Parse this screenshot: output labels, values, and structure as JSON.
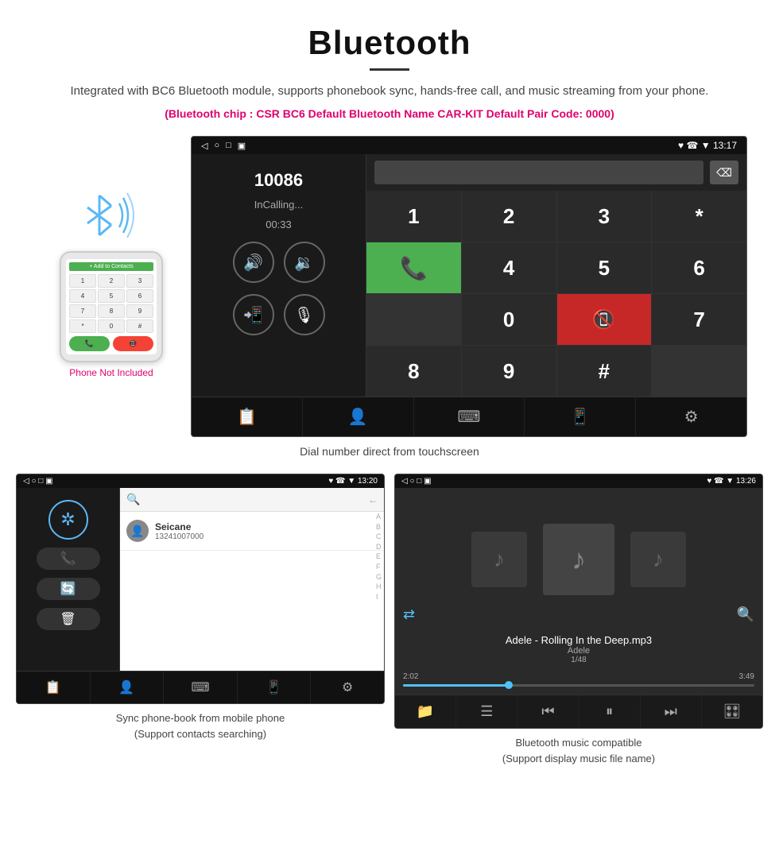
{
  "page": {
    "title": "Bluetooth",
    "divider": true,
    "description": "Integrated with BC6 Bluetooth module, supports phonebook sync, hands-free call, and music streaming from your phone.",
    "specs": "(Bluetooth chip : CSR BC6    Default Bluetooth Name CAR-KIT    Default Pair Code: 0000)"
  },
  "phone_label": "Phone Not Included",
  "top_screen": {
    "status_left": "◁  ○  □  ▣",
    "status_right": "♥  ☎  ▼  13:17",
    "call_number": "10086",
    "call_status": "InCalling...",
    "call_timer": "00:33",
    "dial_keys": [
      "1",
      "2",
      "3",
      "*",
      "4",
      "5",
      "6",
      "0",
      "7",
      "8",
      "9",
      "#"
    ],
    "caption": "Dial number direct from touchscreen"
  },
  "bottom_left": {
    "status_left": "◁  ○  □  ▣",
    "status_right": "♥  ☎  ▼  13:20",
    "contact_name": "Seicane",
    "contact_number": "13241007000",
    "alpha_index": [
      "A",
      "B",
      "C",
      "D",
      "E",
      "F",
      "G",
      "H",
      "I"
    ],
    "caption_line1": "Sync phone-book from mobile phone",
    "caption_line2": "(Support contacts searching)"
  },
  "bottom_right": {
    "status_left": "◁  ○  □  ▣",
    "status_right": "♥  ☎  ▼  13:26",
    "song_title": "Adele - Rolling In the Deep.mp3",
    "artist": "Adele",
    "track_info": "1/48",
    "time_current": "2:02",
    "time_total": "3:49",
    "progress_percent": 30,
    "caption_line1": "Bluetooth music compatible",
    "caption_line2": "(Support display music file name)"
  }
}
